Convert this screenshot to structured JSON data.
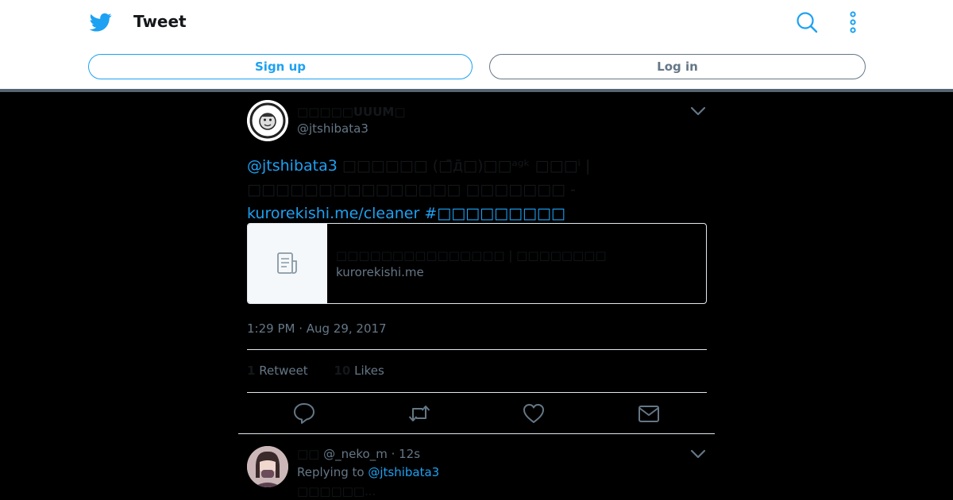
{
  "header": {
    "title": "Tweet",
    "signup_label": "Sign up",
    "login_label": "Log in",
    "icons": [
      "twitter-bird-icon",
      "search-icon",
      "more-icon"
    ],
    "accent_color": "#1da1f2"
  },
  "tweet": {
    "display_name": "□□□□□UUUM□",
    "handle": "@jtshibata3",
    "text_mention": "@jtshibata3",
    "text_body": " □□□□□□ (□̄д̄□)□□ᵃᵍᵏ □□□ⁱ | □□□□□□□□□□□□□□□ □□□□□□□ - ",
    "text_link": "kurorekishi.me/cleaner",
    "text_hashtag": " #□□□□□□□□□",
    "card": {
      "title": "□□□□□□□□□□□□□□□ | □□□□□□□□",
      "domain": "kurorekishi.me"
    },
    "timestamp": "1:29 PM · Aug 29, 2017",
    "retweets_count": "1",
    "retweets_label": "Retweet",
    "likes_count": "10",
    "likes_label": "Likes"
  },
  "reply": {
    "name": "□□",
    "handle_time": " @_neko_m · 12s",
    "replying_prefix": "Replying to ",
    "replying_handle": "@jtshibata3",
    "text": "□□□□□□..."
  }
}
